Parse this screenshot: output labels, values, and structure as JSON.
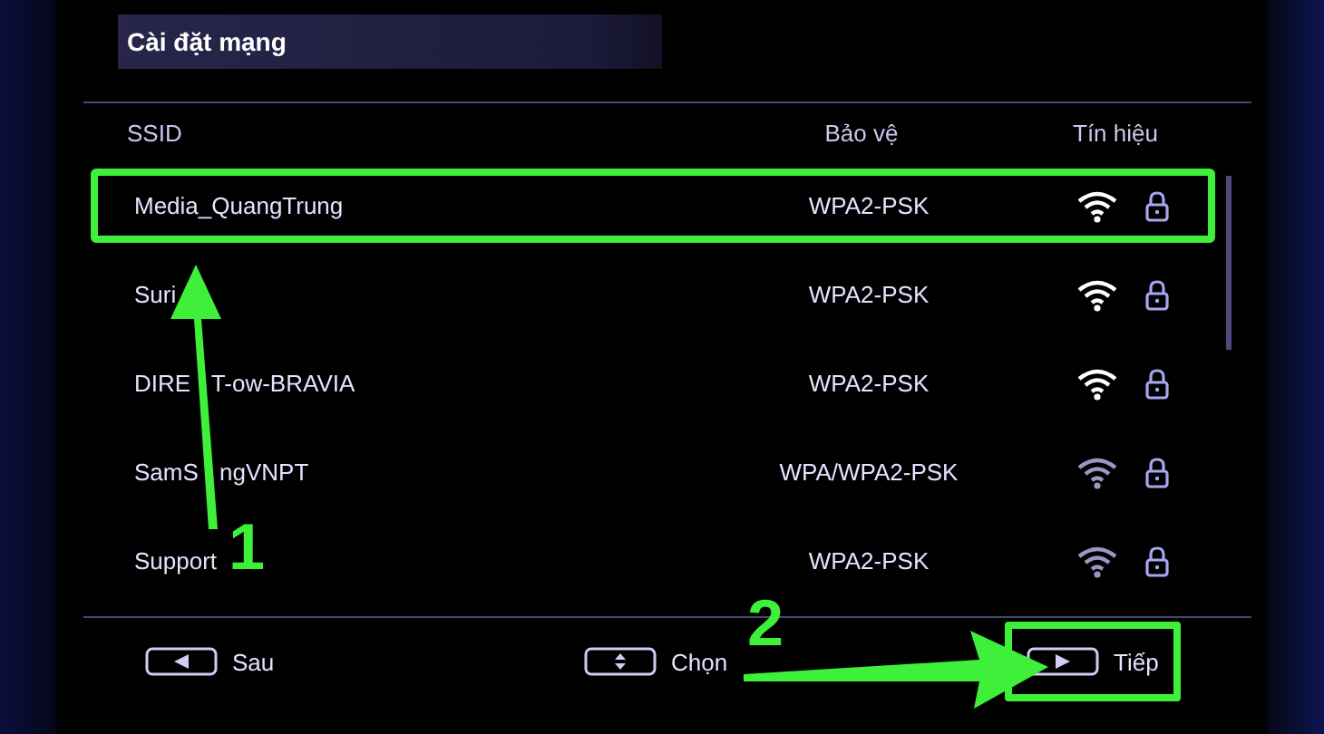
{
  "title": "Cài đặt mạng",
  "columns": [
    "SSID",
    "Bảo vệ",
    "Tín hiệu"
  ],
  "networks": [
    {
      "ssid": "Media_QuangTrung",
      "security": "WPA2-PSK",
      "weak": false,
      "selected": true
    },
    {
      "ssid": "Suri",
      "security": "WPA2-PSK",
      "weak": false,
      "selected": false
    },
    {
      "ssid": "DIRE T-ow-BRAVIA",
      "security": "WPA2-PSK",
      "weak": false,
      "selected": false
    },
    {
      "ssid": "SamS ngVNPT",
      "security": "WPA/WPA2-PSK",
      "weak": true,
      "selected": false
    },
    {
      "ssid": "Support",
      "security": "WPA2-PSK",
      "weak": true,
      "selected": false
    }
  ],
  "footer": [
    {
      "kind": "left",
      "label": "Sau",
      "highlighted": false
    },
    {
      "kind": "updown",
      "label": "Chọn",
      "highlighted": false
    },
    {
      "kind": "right",
      "label": "Tiếp",
      "highlighted": true
    }
  ],
  "annotations": [
    {
      "label": "1"
    },
    {
      "label": "2"
    }
  ]
}
